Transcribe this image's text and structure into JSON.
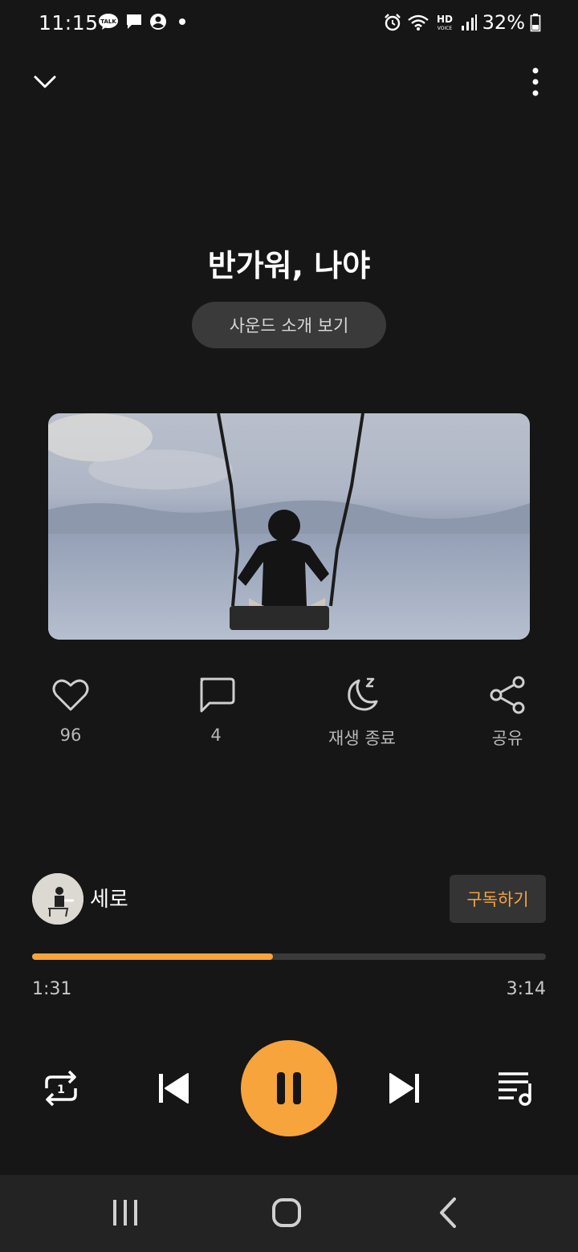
{
  "status_bar": {
    "time": "11:15",
    "battery": "32%",
    "icons": [
      "kakaotalk-icon",
      "message-icon",
      "account-icon",
      "dot-icon",
      "alarm-icon",
      "wifi-icon",
      "hd-voice-icon",
      "signal-icon",
      "battery-icon"
    ]
  },
  "header": {
    "collapse_icon": "chevron-down-icon",
    "more_icon": "more-vertical-icon"
  },
  "track": {
    "title": "반가워, 나야",
    "intro_button": "사운드 소개 보기"
  },
  "actions": {
    "like_count": "96",
    "comment_count": "4",
    "sleep_label": "재생 종료",
    "share_label": "공유"
  },
  "artist": {
    "name": "세로",
    "subscribe_label": "구독하기"
  },
  "progress": {
    "current": "1:31",
    "total": "3:14",
    "fraction": 0.469
  },
  "controls": {
    "repeat_icon": "repeat-one-icon",
    "prev_icon": "skip-previous-icon",
    "play_state": "pause-icon",
    "next_icon": "skip-next-icon",
    "playlist_icon": "playlist-icon"
  },
  "colors": {
    "background": "#161616",
    "accent": "#f7a43c",
    "button_bg": "#3a3a3a",
    "nav_bg": "#232323"
  }
}
